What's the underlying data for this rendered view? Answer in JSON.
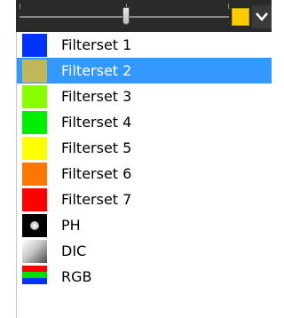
{
  "toolbar": {
    "swatch_color": "#ffcc00"
  },
  "menu": {
    "items": [
      {
        "label": "Filterset 1",
        "color": "#0033ff",
        "icon": "blue-swatch"
      },
      {
        "label": "Filterset 2",
        "color": "#bfb75a",
        "icon": "olive-swatch",
        "selected": true
      },
      {
        "label": "Filterset 3",
        "color": "#88ff00",
        "icon": "lime-swatch"
      },
      {
        "label": "Filterset 4",
        "color": "#00ee00",
        "icon": "green-swatch"
      },
      {
        "label": "Filterset 5",
        "color": "#ffff00",
        "icon": "yellow-swatch"
      },
      {
        "label": "Filterset 6",
        "color": "#ff7700",
        "icon": "orange-swatch"
      },
      {
        "label": "Filterset 7",
        "color": "#ff0000",
        "icon": "red-swatch"
      },
      {
        "label": "PH",
        "icon": "phase-contrast-icon"
      },
      {
        "label": "DIC",
        "icon": "dic-icon"
      },
      {
        "label": "RGB",
        "icon": "rgb-icon",
        "colors": [
          "#ff0000",
          "#00dd00",
          "#0033ff"
        ]
      }
    ]
  }
}
